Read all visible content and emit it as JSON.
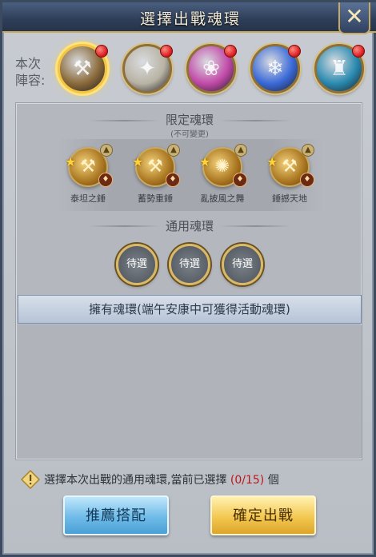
{
  "window": {
    "title": "選擇出戰魂環",
    "close_label": "✕"
  },
  "lineup": {
    "label": "本次陣容:",
    "avatars": [
      {
        "icon": "hammer-hero-icon",
        "color": "#8a6a3a",
        "active": true
      },
      {
        "icon": "white-tiger-hero-icon",
        "color": "#b9b3a4",
        "active": false
      },
      {
        "icon": "pink-girl-hero-icon",
        "color": "#c24aa8",
        "active": false
      },
      {
        "icon": "blue-crystal-hero-icon",
        "color": "#3a6ad8",
        "active": false
      },
      {
        "icon": "cyan-tower-hero-icon",
        "color": "#2a8ab0",
        "active": false
      }
    ]
  },
  "limited_section": {
    "title": "限定魂環",
    "subtitle": "(不可變更)",
    "items": [
      {
        "name": "泰坦之錘",
        "icon": "golden-hammer-icon"
      },
      {
        "name": "蓄勢重錘",
        "icon": "heavy-hammer-icon"
      },
      {
        "name": "亂披風之舞",
        "icon": "wind-dance-icon"
      },
      {
        "name": "錘撼天地",
        "icon": "earth-hammer-icon"
      }
    ]
  },
  "general_section": {
    "title": "通用魂環",
    "slots": [
      "待選",
      "待選",
      "待選"
    ]
  },
  "owned": {
    "label": "擁有魂環(端午安康中可獲得活動魂環)"
  },
  "hint": {
    "text": "選擇本次出戰的通用魂環,當前已選擇",
    "count": "(0/15)",
    "suffix": "個"
  },
  "buttons": {
    "recommend": "推薦搭配",
    "confirm": "確定出戰"
  }
}
